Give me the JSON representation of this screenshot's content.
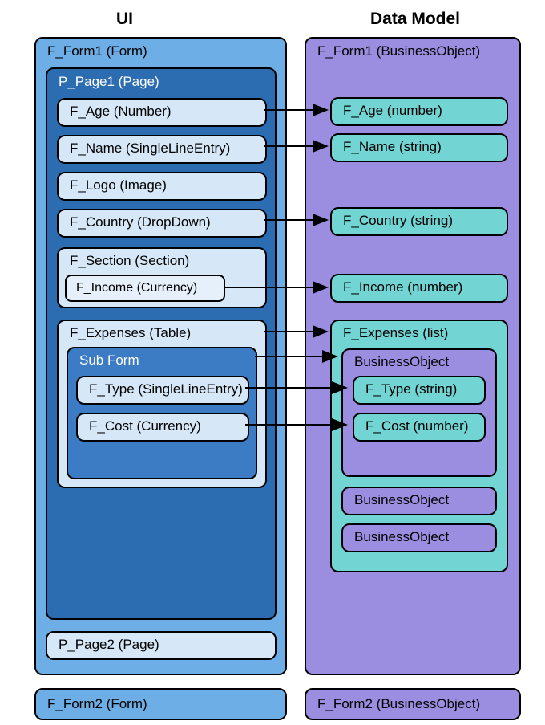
{
  "diagram": {
    "headers": {
      "ui": "UI",
      "data": "Data Model"
    },
    "left": {
      "form1": {
        "label": "F_Form1 (Form)",
        "page1": {
          "label": "P_Page1 (Page)",
          "fields": {
            "age": "F_Age (Number)",
            "name": "F_Name (SingleLineEntry)",
            "logo": "F_Logo (Image)",
            "country": "F_Country (DropDown)"
          },
          "section": {
            "label": "F_Section (Section)",
            "income": "F_Income (Currency)"
          },
          "expenses": {
            "label": "F_Expenses (Table)",
            "subform": {
              "label": "Sub Form",
              "type": "F_Type (SingleLineEntry)",
              "cost": "F_Cost (Currency)"
            }
          }
        },
        "page2": "P_Page2 (Page)"
      },
      "form2": "F_Form2 (Form)"
    },
    "right": {
      "form1bo": {
        "label": "F_Form1 (BusinessObject)",
        "fields": {
          "age": "F_Age (number)",
          "name": "F_Name (string)",
          "country": "F_Country (string)",
          "income": "F_Income (number)"
        },
        "expenses": {
          "label": "F_Expenses (list)",
          "bo1": {
            "label": "BusinessObject",
            "type": "F_Type (string)",
            "cost": "F_Cost (number)"
          },
          "bo2": "BusinessObject",
          "bo3": "BusinessObject"
        }
      },
      "form2bo": "F_Form2 (BusinessObject)"
    }
  }
}
